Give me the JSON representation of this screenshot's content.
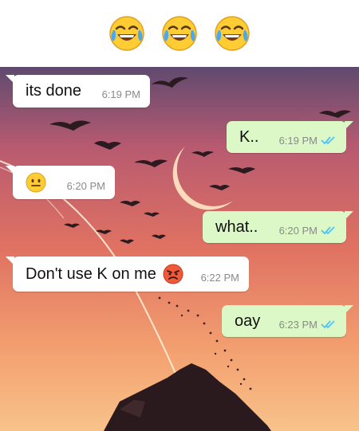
{
  "header_emojis": [
    "face-with-tears-of-joy-icon",
    "face-with-tears-of-joy-icon",
    "face-with-tears-of-joy-icon"
  ],
  "messages": [
    {
      "direction": "incoming",
      "text": "its done",
      "time": "6:19 PM"
    },
    {
      "direction": "outgoing",
      "text": "K..",
      "time": "6:19 PM",
      "status": "read"
    },
    {
      "direction": "incoming",
      "text": "",
      "emoji": "neutral-face-icon",
      "time": "6:20 PM"
    },
    {
      "direction": "outgoing",
      "text": "what..",
      "time": "6:20 PM",
      "status": "read"
    },
    {
      "direction": "incoming",
      "text": "Don't use K on me",
      "emoji": "angry-face-icon",
      "time": "6:22 PM"
    },
    {
      "direction": "outgoing",
      "text": "oay",
      "time": "6:23 PM",
      "status": "read"
    }
  ],
  "colors": {
    "incoming_bubble": "#ffffff",
    "outgoing_bubble": "#dcf8c6",
    "read_ticks": "#4fc3f7",
    "timestamp": "#8a8a8a"
  }
}
